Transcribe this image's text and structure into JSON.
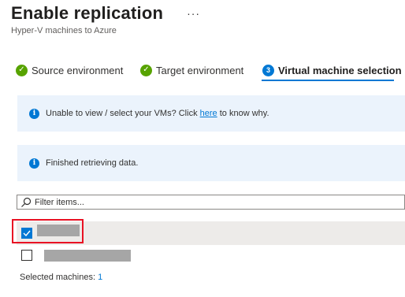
{
  "header": {
    "title": "Enable replication",
    "subtitle": "Hyper-V machines to Azure",
    "more_label": "···"
  },
  "steps": [
    {
      "label": "Source environment",
      "state": "completed",
      "icon": "check-icon"
    },
    {
      "label": "Target environment",
      "state": "completed",
      "icon": "check-icon"
    },
    {
      "label": "Virtual machine selection",
      "state": "active",
      "number": "3"
    }
  ],
  "banners": {
    "vm_help": {
      "text_before": "Unable to view / select your VMs? Click ",
      "link": "here",
      "text_after": " to know why."
    },
    "status": {
      "text": "Finished retrieving data."
    }
  },
  "filter": {
    "placeholder": "Filter items..."
  },
  "machines": [
    {
      "name": "",
      "checked": true,
      "redacted": true
    },
    {
      "name": "",
      "checked": false,
      "redacted": true
    }
  ],
  "footer": {
    "label": "Selected machines: ",
    "count": "1"
  },
  "colors": {
    "accent": "#0078d4",
    "success": "#57a300",
    "highlight": "#e81123",
    "banner_bg": "#ebf3fc"
  }
}
